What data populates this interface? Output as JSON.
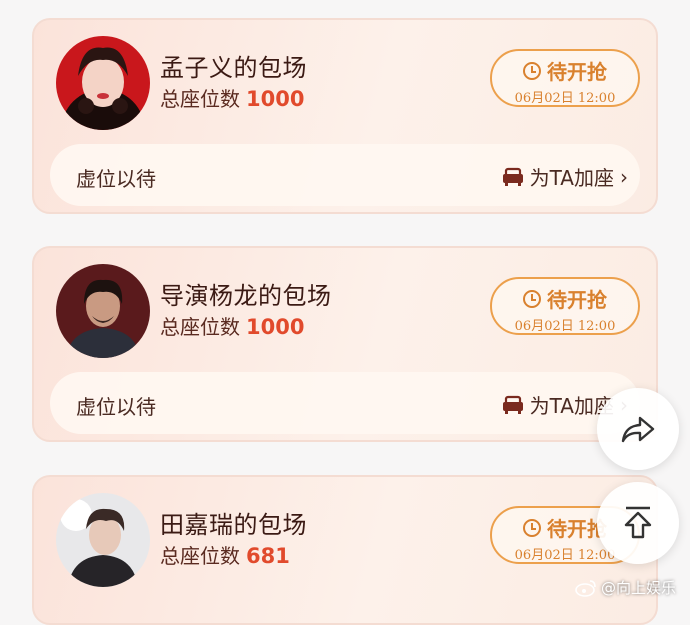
{
  "cards": [
    {
      "title": "孟子义的包场",
      "seats_label": "总座位数",
      "seats_value": "1000",
      "status": "待开抢",
      "time": "06月02日 12:00",
      "bar_label": "虚位以待",
      "action_label": "为TA加座"
    },
    {
      "title": "导演杨龙的包场",
      "seats_label": "总座位数",
      "seats_value": "1000",
      "status": "待开抢",
      "time": "06月02日 12:00",
      "bar_label": "虚位以待",
      "action_label": "为TA加座"
    },
    {
      "title": "田嘉瑞的包场",
      "seats_label": "总座位数",
      "seats_value": "681",
      "status": "待开抢",
      "time": "06月02日 12:00",
      "bar_label": "",
      "action_label": ""
    }
  ],
  "watermark": "@向上娱乐",
  "colors": {
    "accent": "#e14a2c",
    "status": "#d9812e",
    "text": "#3b1a14"
  }
}
